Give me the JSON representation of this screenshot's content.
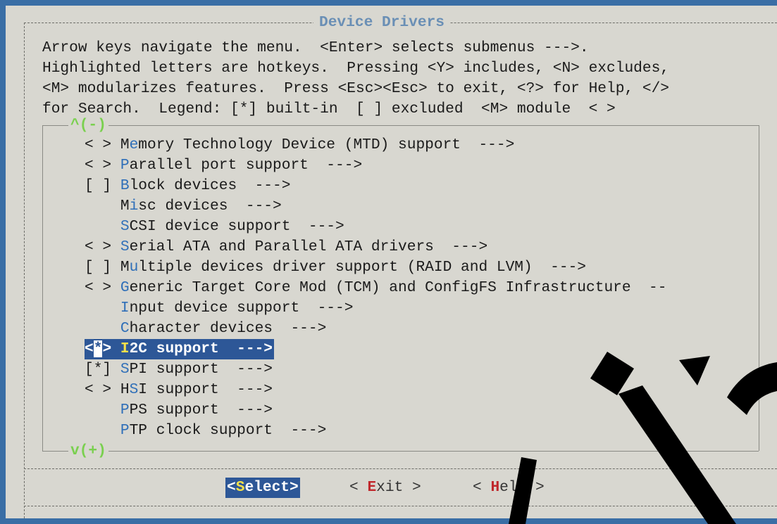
{
  "dialog": {
    "title": "Device Drivers"
  },
  "help_text": [
    "Arrow keys navigate the menu.  <Enter> selects submenus --->.",
    "Highlighted letters are hotkeys.  Pressing <Y> includes, <N> excludes,",
    "<M> modularizes features.  Press <Esc><Esc> to exit, <?> for Help, </>",
    "for Search.  Legend: [*] built-in  [ ] excluded  <M> module  < >"
  ],
  "scroll": {
    "up": "^(-)",
    "down": "v(+)"
  },
  "menu": {
    "items": [
      {
        "prefix": "< > ",
        "pre": "M",
        "hotkey": "e",
        "post": "mory Technology Device (MTD) support  --->"
      },
      {
        "prefix": "< > ",
        "pre": "",
        "hotkey": "P",
        "post": "arallel port support  --->"
      },
      {
        "prefix": "[ ] ",
        "pre": "",
        "hotkey": "B",
        "post": "lock devices  --->"
      },
      {
        "prefix": "    ",
        "pre": "M",
        "hotkey": "i",
        "post": "sc devices  --->"
      },
      {
        "prefix": "    ",
        "pre": "",
        "hotkey": "S",
        "post": "CSI device support  --->"
      },
      {
        "prefix": "< > ",
        "pre": "",
        "hotkey": "S",
        "post": "erial ATA and Parallel ATA drivers  --->"
      },
      {
        "prefix": "[ ] ",
        "pre": "M",
        "hotkey": "u",
        "post": "ltiple devices driver support (RAID and LVM)  --->"
      },
      {
        "prefix": "< > ",
        "pre": "",
        "hotkey": "G",
        "post": "eneric Target Core Mod (TCM) and ConfigFS Infrastructure  --"
      },
      {
        "prefix": "    ",
        "pre": "",
        "hotkey": "I",
        "post": "nput device support  --->"
      },
      {
        "prefix": "    ",
        "pre": "",
        "hotkey": "C",
        "post": "haracter devices  --->"
      },
      {
        "prefix_open": "<",
        "prefix_star": "*",
        "prefix_close": "> ",
        "pre": "",
        "hotkey": "I",
        "post": "2C support  --->",
        "selected": true
      },
      {
        "prefix": "[*] ",
        "pre": "",
        "hotkey": "S",
        "post": "PI support  --->"
      },
      {
        "prefix": "< > ",
        "pre": "H",
        "hotkey": "S",
        "post": "I support  --->"
      },
      {
        "prefix": "    ",
        "pre": "",
        "hotkey": "P",
        "post": "PS support  --->"
      },
      {
        "prefix": "    ",
        "pre": "",
        "hotkey": "P",
        "post": "TP clock support  --->"
      }
    ]
  },
  "buttons": {
    "select": {
      "open": "<",
      "hotkey": "S",
      "rest": "elect>"
    },
    "exit": {
      "open": "< ",
      "hotkey": "E",
      "rest": "xit >"
    },
    "help": {
      "open": "< ",
      "hotkey": "H",
      "rest": "elp >"
    }
  },
  "colors": {
    "background": "#d8d7d0",
    "hotkey": "#2f6fb8",
    "selection": "#2d5797",
    "selected_hotkey": "#f5e14a",
    "button_hotkey": "#c0282c",
    "scroll_indicator": "#7ad04f",
    "title": "#6a8fb5"
  }
}
